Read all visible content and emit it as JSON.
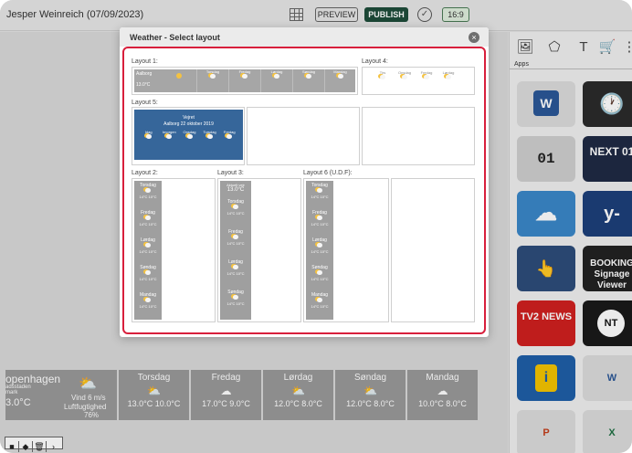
{
  "topbar": {
    "user": "Jesper Weinreich (07/09/2023)",
    "preview_label": "PREVIEW",
    "publish_label": "PUBLISH",
    "ratio_label": "16:9"
  },
  "background_forecast": {
    "city": "openhagen",
    "sub1": "adsstaden",
    "sub2": "mark",
    "current_temp": "3.0°C",
    "wind": "Vind 6 m/s",
    "humidity_label": "Luftfugtighed",
    "humidity": "76%",
    "days": [
      {
        "name": "Torsdag",
        "temps": "13.0°C 10.0°C"
      },
      {
        "name": "Fredag",
        "temps": "17.0°C 9.0°C"
      },
      {
        "name": "Lørdag",
        "temps": "12.0°C 8.0°C"
      },
      {
        "name": "Søndag",
        "temps": "12.0°C 8.0°C"
      },
      {
        "name": "Mandag",
        "temps": "10.0°C 8.0°C"
      }
    ]
  },
  "apps_panel": {
    "label": "Apps",
    "tiles": [
      {
        "name": "W"
      },
      {
        "name": "🕐"
      },
      {
        "name": "01"
      },
      {
        "name": "NEXT 01"
      },
      {
        "name": "☁"
      },
      {
        "name": "y-"
      },
      {
        "name": "👆"
      },
      {
        "name": "BOOKING Signage Viewer"
      },
      {
        "name": "TV2 NEWS"
      },
      {
        "name": "NT"
      },
      {
        "name": "i"
      },
      {
        "name": "W"
      },
      {
        "name": "P"
      },
      {
        "name": "X"
      }
    ]
  },
  "dialog": {
    "title": "Weather - Select layout",
    "layouts": [
      {
        "label": "Layout 1:"
      },
      {
        "label": "Layout 4:"
      },
      {
        "label": "Layout 5:"
      },
      {
        "label": "Layout 2:"
      },
      {
        "label": "Layout 3:"
      },
      {
        "label": "Layout 6 (U.D.F):"
      }
    ],
    "thumb1": {
      "city": "Aalborg",
      "temp": "13.0°C",
      "days": [
        "Torsdag",
        "Fredag",
        "Lørdag",
        "Søndag",
        "Mandag"
      ]
    },
    "thumb4": {
      "days": [
        "Tirs",
        "Onsdag",
        "Fredag",
        "Lørdag"
      ]
    },
    "thumb5": {
      "title": "Vejret",
      "subtitle": "Aalborg 22 oktober 2019",
      "days": [
        "Idag",
        "Imorgen",
        "Onsdag",
        "Torsdag",
        "Fredag"
      ]
    },
    "thumb_vertical": {
      "days": [
        "Torsdag",
        "Fredag",
        "Lørdag",
        "Søndag",
        "Mandag"
      ],
      "temps": "14°C 10°C",
      "current_label": "Aktuelt vejr",
      "current_temp": "13.0°C"
    }
  }
}
